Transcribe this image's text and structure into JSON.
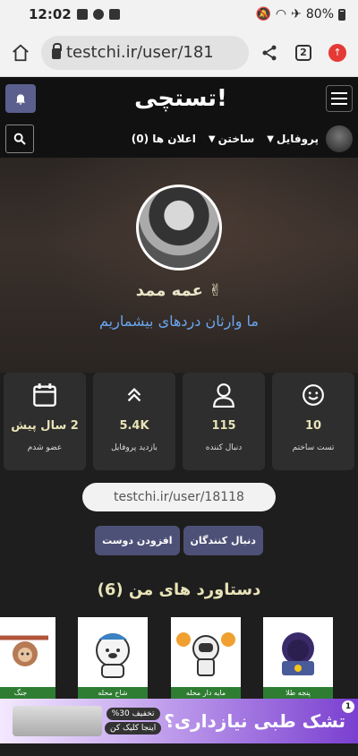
{
  "status_bar": {
    "time": "12:02",
    "battery": "80%"
  },
  "browser": {
    "url": "testchi.ir/user/181",
    "tab_count": "2",
    "update_badge": "↑"
  },
  "header": {
    "logo": "تستچی!"
  },
  "sub_nav": {
    "profile": "پروفایل",
    "create": "ساختن",
    "notifications": "اعلان ها (0)"
  },
  "profile": {
    "name": "عمه ممد ✌",
    "bio": "ما وارثان دردهای بیشماریم"
  },
  "stats": [
    {
      "value": "10",
      "label": "تست ساختم",
      "icon": "smile-icon"
    },
    {
      "value": "115",
      "label": "دنبال کننده",
      "icon": "user-icon"
    },
    {
      "value": "5.4K",
      "label": "بازدید پروفایل",
      "icon": "chevrons-up-icon"
    },
    {
      "value": "2 سال پیش",
      "label": "عضو شدم",
      "icon": "calendar-icon"
    }
  ],
  "profile_url": "testchi.ir/user/18118",
  "buttons": {
    "followers": "دنبال کنندگان",
    "add_friend": "افزودن دوست"
  },
  "achievements": {
    "title": "دستاورد های من (6)",
    "items": [
      {
        "label": "پنجه طلا"
      },
      {
        "label": "مایه دار محله"
      },
      {
        "label": "شاخ محله"
      },
      {
        "label": "جنگ"
      }
    ]
  },
  "ad": {
    "badge": "1",
    "text": "تشک طبی نیازداری؟",
    "offer": "%30 تخفیف",
    "offer_sub": "اینجا کلیک کن"
  },
  "colors": {
    "accent": "#5b5f8e",
    "stat_value": "#e8e3b7",
    "bio": "#6aa6ef",
    "ach_label": "#2e7d32"
  }
}
